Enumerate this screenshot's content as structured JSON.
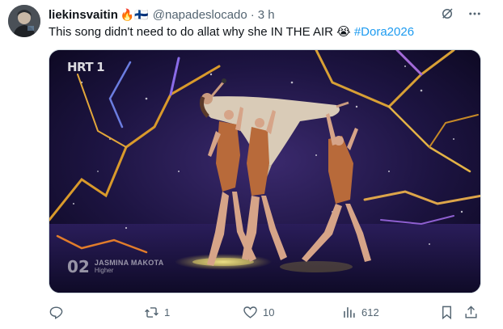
{
  "user": {
    "display_name": "liekinsvaitin",
    "name_emojis": "🔥🇫🇮",
    "handle": "@napadeslocado",
    "separator": "·",
    "time": "3 h"
  },
  "tweet": {
    "text_main": "This song didn't need to do allat why she IN THE AIR",
    "text_emoji": "😭",
    "hashtag": "#Dora2026"
  },
  "media": {
    "channel_logo": "HRT",
    "channel_number": "1",
    "performer_number": "02",
    "performer_name": "JASMINA MAKOTA",
    "song_title": "Higher"
  },
  "actions": {
    "replies": {
      "icon": "reply-icon",
      "count": ""
    },
    "reposts": {
      "icon": "repost-icon",
      "count": "1"
    },
    "likes": {
      "icon": "heart-icon",
      "count": "10"
    },
    "views": {
      "icon": "views-icon",
      "count": "612"
    },
    "bookmark": {
      "icon": "bookmark-icon"
    },
    "share": {
      "icon": "share-icon"
    }
  },
  "header_icons": [
    "grok-icon",
    "more-icon"
  ],
  "colors": {
    "text": "#0f1419",
    "secondary": "#536471",
    "link": "#1d9bf0"
  }
}
